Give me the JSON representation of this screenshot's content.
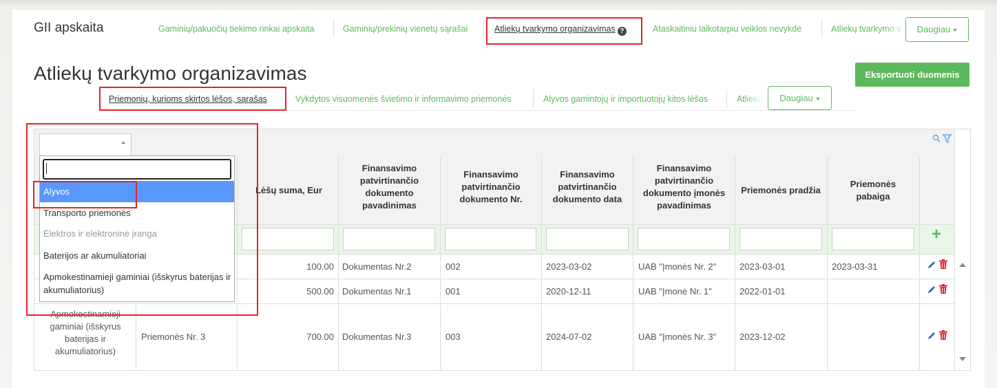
{
  "app": {
    "brand": "GII apskaita"
  },
  "topnav": {
    "items": [
      {
        "label": "Gaminių/pakuočių tiekimo rinkai apskaita"
      },
      {
        "label": "Gaminių/prekinių vienetų sąrašai"
      },
      {
        "label": "Atliekų tvarkymo organizavimas",
        "active": true
      },
      {
        "label": "Ataskaitiniu laikotarpiu veiklos nevykdė"
      },
      {
        "label": "Atliekų tvarkymo s"
      }
    ],
    "more_label": "Daugiau"
  },
  "page": {
    "title": "Atliekų tvarkymo organizavimas",
    "export_label": "Eksportuoti duomenis"
  },
  "subnav": {
    "items": [
      {
        "label": "Priemonių, kurioms skirtos lėšos, sąrašas",
        "active": true
      },
      {
        "label": "Vykdytos visuomenės švietimo ir informavimo priemonės"
      },
      {
        "label": "Alyvos gamintojų ir importuotojų kitos lėšos"
      },
      {
        "label": "Atliekų"
      }
    ],
    "more_label": "Daugiau"
  },
  "table": {
    "columns": [
      "Lėšų suma, Eur",
      "Finansavimo patvirtinančio dokumento pavadinimas",
      "Finansavimo patvirtinančio dokumento Nr.",
      "Finansavimo patvirtinančio dokumento data",
      "Finansavimo patvirtinančio dokumento įmonės pavadinimas",
      "Priemonės pradžia",
      "Priemonės pabaiga"
    ],
    "rows": [
      {
        "category": "",
        "name": "",
        "amount": "100.00",
        "doc_name": "Dokumentas Nr.2",
        "doc_no": "002",
        "doc_date": "2023-03-02",
        "company": "UAB \"Įmonės Nr. 2\"",
        "start": "2023-03-01",
        "end": "2023-03-31"
      },
      {
        "category": "",
        "name": "",
        "amount": "500.00",
        "doc_name": "Dokumentas Nr.1",
        "doc_no": "001",
        "doc_date": "2020-12-11",
        "company": "UAB \"Įmonė Nr. 1\"",
        "start": "2022-01-01",
        "end": ""
      },
      {
        "category": "Apmokestinamieji gaminiai (išskyrus baterijas ir akumuliatorius)",
        "name": "Priemonės Nr. 3",
        "amount": "700.00",
        "doc_name": "Dokumentas Nr.3",
        "doc_no": "003",
        "doc_date": "2024-07-02",
        "company": "UAB \"Įmonės Nr. 3\"",
        "start": "2023-12-02",
        "end": ""
      }
    ]
  },
  "dropdown": {
    "search_value": "",
    "options": [
      {
        "label": "Alyvos",
        "selected": true
      },
      {
        "label": "Transporto priemonės"
      },
      {
        "label": "Elektros ir elektroninė įranga",
        "disabled": true
      },
      {
        "label": "Baterijos ar akumuliatoriai"
      },
      {
        "label": "Apmokestinamieji gaminiai (išskyrus baterijas ir akumuliatorius)"
      }
    ]
  },
  "icons": {
    "help": "help-icon",
    "search": "search-icon",
    "filter": "filter-icon",
    "add": "plus-icon",
    "edit": "pencil-icon",
    "delete": "trash-icon"
  },
  "colors": {
    "accent": "#5cb85c",
    "highlight": "#e2222a",
    "selected": "#5897fb",
    "delete": "#d9262f",
    "edit": "#2a6bb5"
  }
}
